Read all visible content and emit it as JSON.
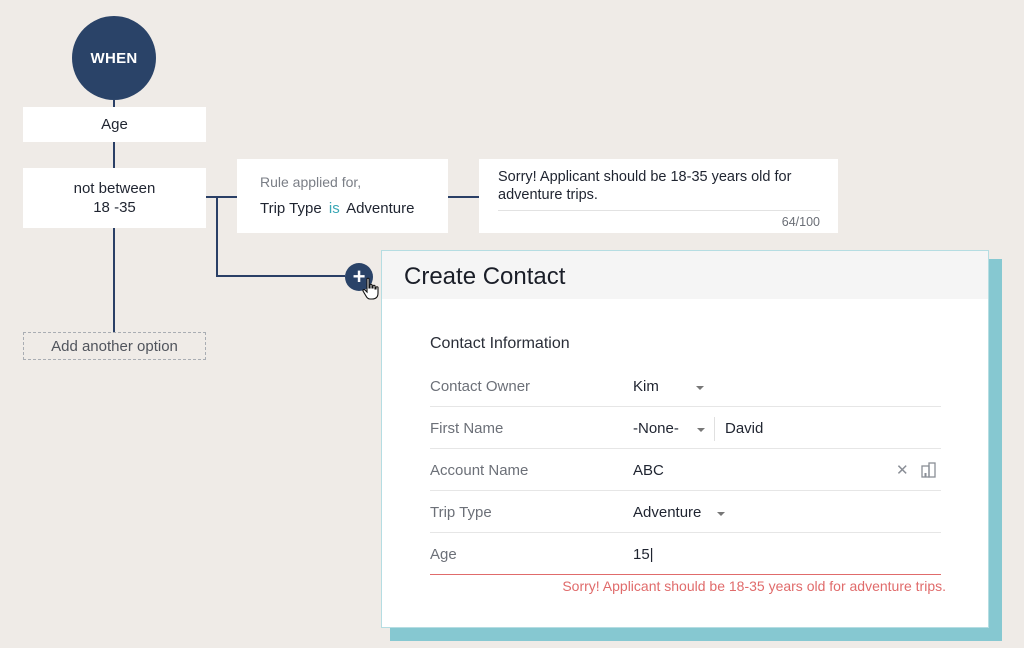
{
  "flow": {
    "when_label": "WHEN",
    "field_node": "Age",
    "condition_line1": "not between",
    "condition_line2": "18 -35",
    "add_option_label": "Add another option"
  },
  "rule": {
    "title": "Rule applied for,",
    "field": "Trip Type",
    "operator": "is",
    "value": "Adventure"
  },
  "message": {
    "text": "Sorry! Applicant should be 18-35 years old for adventure trips.",
    "char_count": "64/100"
  },
  "form": {
    "title": "Create Contact",
    "section_title": "Contact Information",
    "rows": [
      {
        "label": "Contact Owner",
        "value": "Kim"
      },
      {
        "label": "First Name",
        "salutation": "-None-",
        "value": "David"
      },
      {
        "label": "Account Name",
        "value": "ABC"
      },
      {
        "label": "Trip Type",
        "value": "Adventure"
      },
      {
        "label": "Age",
        "value": "15|"
      }
    ],
    "error_message": "Sorry! Applicant should be 18-35 years old for adventure trips."
  },
  "colors": {
    "navy": "#2a4368",
    "accent_teal": "#86c8d1",
    "error_red": "#e06b6b",
    "operator_teal": "#3aa7b5"
  },
  "icons": [
    "plus-icon",
    "hand-cursor-icon",
    "chevron-down-icon",
    "clear-icon",
    "lookup-icon"
  ]
}
